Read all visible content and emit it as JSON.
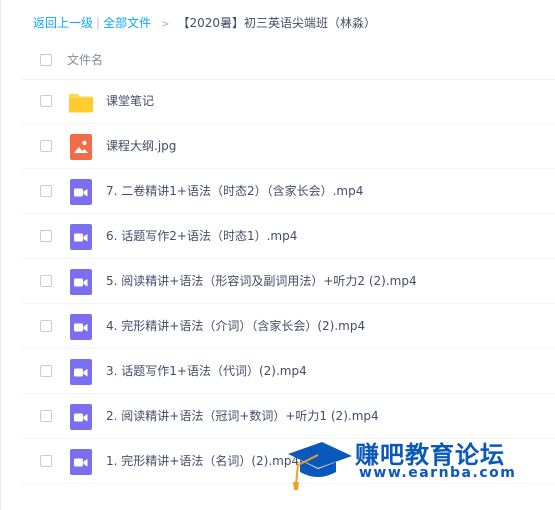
{
  "breadcrumb": {
    "back": "返回上一级",
    "separator": "|",
    "all_files": "全部文件",
    "arrow": ">",
    "current": "【2020暑】初三英语尖端班（林淼）"
  },
  "table": {
    "column_name": "文件名"
  },
  "files": [
    {
      "name": "课堂笔记",
      "type": "folder"
    },
    {
      "name": "课程大纲.jpg",
      "type": "image"
    },
    {
      "name": "7. 二卷精讲1+语法（时态2）（含家长会）.mp4",
      "type": "video"
    },
    {
      "name": "6. 话题写作2+语法（时态1）.mp4",
      "type": "video"
    },
    {
      "name": "5. 阅读精讲+语法（形容词及副词用法）+听力2 (2).mp4",
      "type": "video"
    },
    {
      "name": "4. 完形精讲+语法（介词）（含家长会）(2).mp4",
      "type": "video"
    },
    {
      "name": "3. 话题写作1+语法（代词）(2).mp4",
      "type": "video"
    },
    {
      "name": "2. 阅读精讲+语法（冠词+数词）+听力1 (2).mp4",
      "type": "video"
    },
    {
      "name": "1. 完形精讲+语法（名词）(2).mp4",
      "type": "video"
    }
  ],
  "watermark": {
    "title": "赚吧教育论坛",
    "url": "www.earnba.com"
  },
  "colors": {
    "link": "#09aaff",
    "folder": "#ffd84d",
    "image_icon": "#f26c4a",
    "video_icon": "#7b6ff0",
    "watermark": "#0a58b9"
  }
}
